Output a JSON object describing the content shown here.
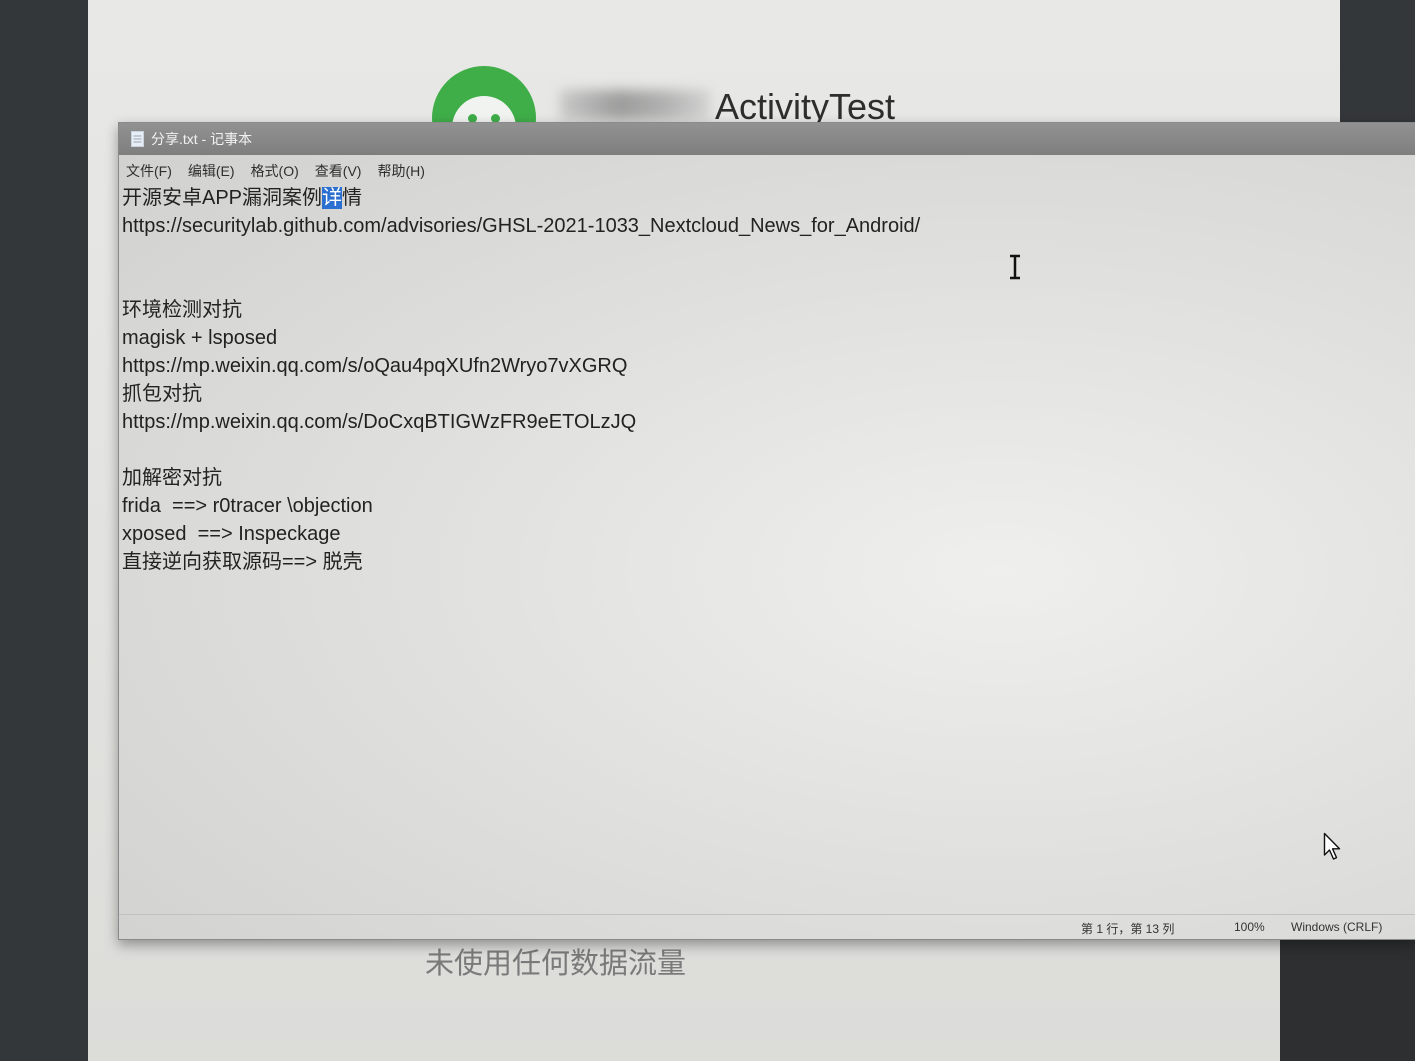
{
  "background_app": {
    "title": "ActivityTest",
    "data_usage_text": "未使用任何数据流量"
  },
  "notepad": {
    "window_title": "分享.txt - 记事本",
    "menu": [
      "文件(F)",
      "编辑(E)",
      "格式(O)",
      "查看(V)",
      "帮助(H)"
    ],
    "first_line": {
      "before": "开源安卓APP漏洞案例",
      "selected": "详",
      "after": "情"
    },
    "lines": [
      "https://securitylab.github.com/advisories/GHSL-2021-1033_Nextcloud_News_for_Android/",
      "",
      "",
      "环境检测对抗",
      "magisk + lsposed",
      "https://mp.weixin.qq.com/s/oQau4pqXUfn2Wryo7vXGRQ",
      "抓包对抗",
      "https://mp.weixin.qq.com/s/DoCxqBTIGWzFR9eETOLzJQ",
      "",
      "加解密对抗",
      "frida  ==> r0tracer \\objection",
      "xposed  ==> Inspeckage",
      "直接逆向获取源码==> 脱壳"
    ],
    "status": {
      "cursor_position": "第 1 行，第 13 列",
      "zoom": "100%",
      "line_ending": "Windows (CRLF)"
    }
  },
  "icons": {
    "app": "android-app-icon",
    "notepad": "notepad-icon",
    "text_cursor": "text-cursor-icon",
    "pointer": "mouse-pointer-icon"
  },
  "colors": {
    "selection": "#2b6fd0",
    "android_green": "#3fae49",
    "title_bar": "#858585"
  }
}
